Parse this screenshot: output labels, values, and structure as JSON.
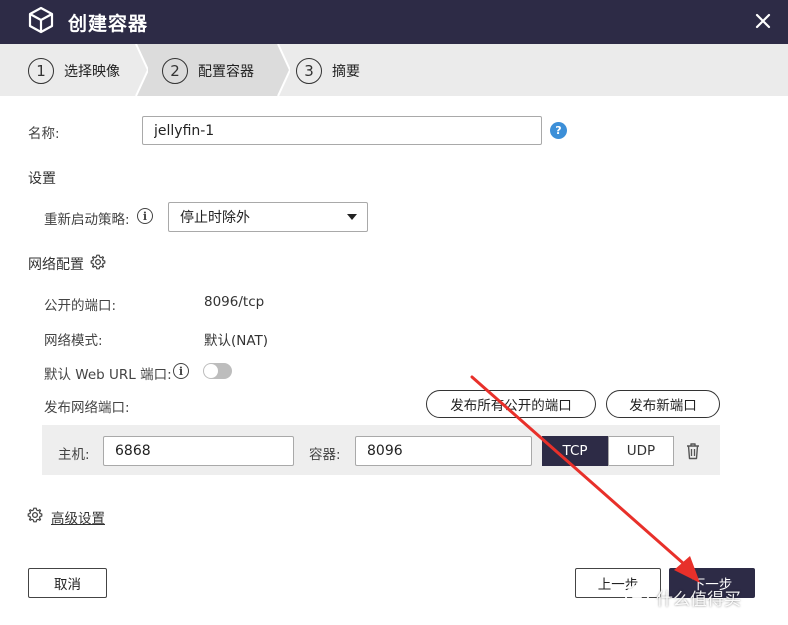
{
  "window": {
    "title": "创建容器"
  },
  "steps": [
    {
      "num": "1",
      "label": "选择映像"
    },
    {
      "num": "2",
      "label": "配置容器"
    },
    {
      "num": "3",
      "label": "摘要"
    }
  ],
  "form": {
    "name_label": "名称:",
    "name_value": "jellyfin-1",
    "settings_title": "设置",
    "restart_label": "重新启动策略:",
    "restart_value": "停止时除外",
    "network_title": "网络配置",
    "public_port_label": "公开的端口:",
    "public_port_value": "8096/tcp",
    "network_mode_label": "网络模式:",
    "network_mode_value": "默认(NAT)",
    "web_url_label": "默认 Web URL 端口:",
    "publish_label": "发布网络端口:",
    "publish_all_button": "发布所有公开的端口",
    "publish_new_button": "发布新端口",
    "host_label": "主机:",
    "host_value": "6868",
    "container_label": "容器:",
    "container_value": "8096",
    "protocol_tcp": "TCP",
    "protocol_udp": "UDP",
    "advanced_link": "高级设置"
  },
  "footer": {
    "cancel": "取消",
    "prev": "上一步",
    "next": "下一步"
  },
  "watermark": {
    "text": "什么值得买"
  },
  "colors": {
    "header_bg": "#2d2b46",
    "accent": "#2d2b46",
    "help_blue": "#3c8fd8",
    "annotation_red": "#e8302a"
  }
}
